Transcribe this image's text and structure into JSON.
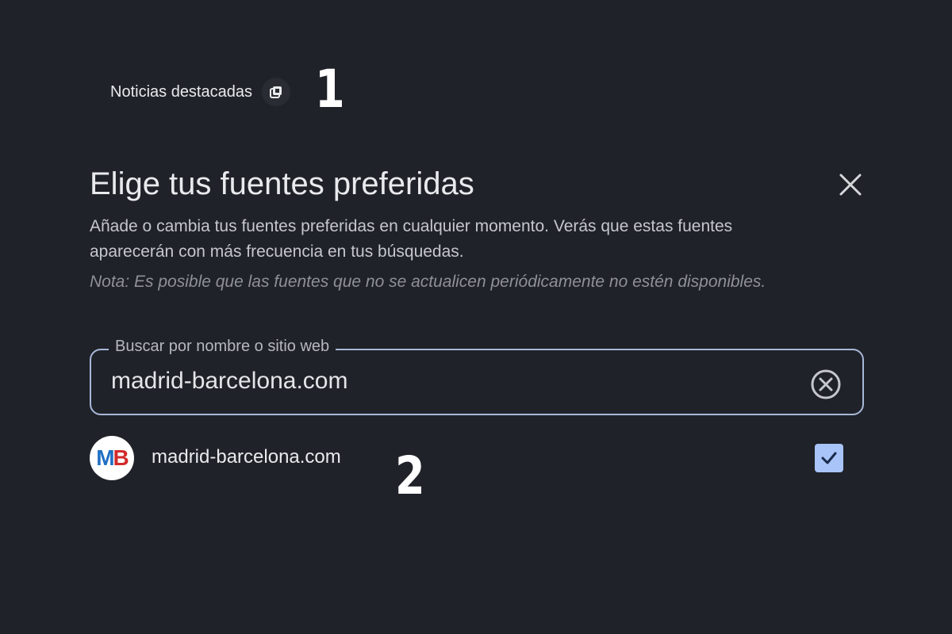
{
  "top": {
    "label": "Noticias destacadas",
    "icon": "open-source-icon"
  },
  "annotations": {
    "step1": "1",
    "step2": "2"
  },
  "dialog": {
    "title": "Elige tus fuentes preferidas",
    "close_icon": "close-icon",
    "description": "Añade o cambia tus fuentes preferidas en cualquier momento. Verás que estas fuentes aparecerán con más frecuencia en tus búsquedas.",
    "note": "Nota: Es posible que las fuentes que no se actualicen periódicamente no estén disponibles."
  },
  "search": {
    "label": "Buscar por nombre o sitio web",
    "value": "madrid-barcelona.com",
    "clear_icon": "clear-circle-icon"
  },
  "results": [
    {
      "logo_text_1": "M",
      "logo_text_2": "B",
      "name": "madrid-barcelona.com",
      "checked": true
    }
  ],
  "colors": {
    "background": "#202229",
    "field_border": "#a8b8d8",
    "checkbox": "#a8c4f8",
    "logo_blue": "#1f6fc4",
    "logo_red": "#d22a2a"
  }
}
